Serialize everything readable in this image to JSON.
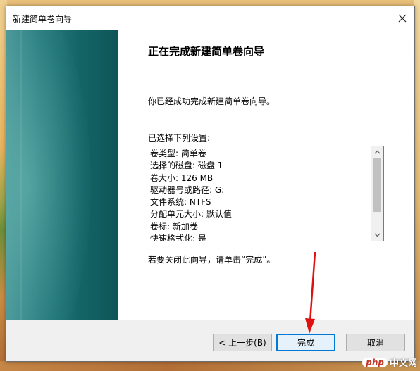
{
  "window": {
    "title": "新建简单卷向导",
    "close_icon": "close-icon"
  },
  "content": {
    "heading": "正在完成新建简单卷向导",
    "message": "你已经成功完成新建简单卷向导。",
    "settings_label": "已选择下列设置:",
    "settings": [
      "卷类型: 简单卷",
      "选择的磁盘: 磁盘 1",
      "卷大小: 126 MB",
      "驱动器号或路径: G:",
      "文件系统: NTFS",
      "分配单元大小: 默认值",
      "卷标: 新加卷",
      "快速格式化: 是"
    ],
    "finish_hint": "若要关闭此向导，请单击“完成”。"
  },
  "buttons": {
    "back": "< 上一步(B)",
    "finish": "完成",
    "cancel": "取消"
  },
  "watermark": {
    "logo": "php",
    "text": "中文网"
  },
  "colors": {
    "accent": "#0078d7",
    "annotation_arrow": "#e01010",
    "sidebar": "#146567"
  }
}
